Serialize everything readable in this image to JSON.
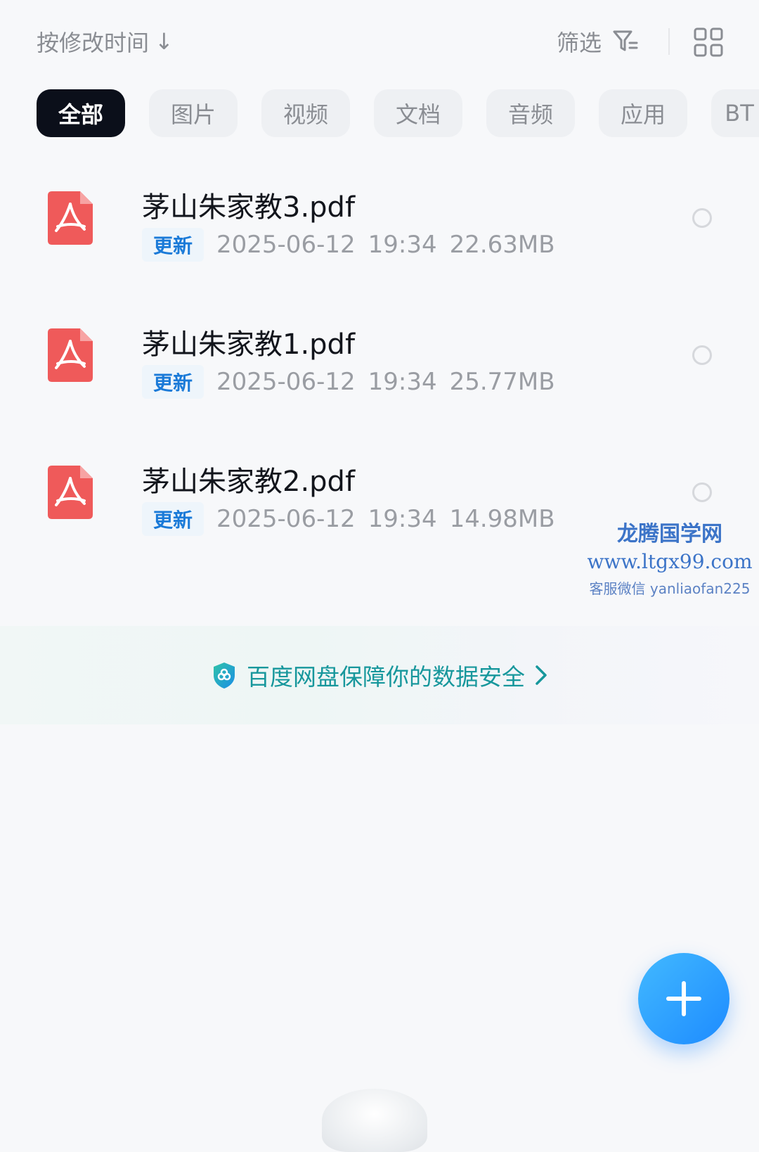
{
  "toolbar": {
    "sort_label": "按修改时间",
    "sort_arrow": "↓",
    "filter_label": "筛选"
  },
  "tabs": [
    {
      "label": "全部",
      "active": true
    },
    {
      "label": "图片",
      "active": false
    },
    {
      "label": "视频",
      "active": false
    },
    {
      "label": "文档",
      "active": false
    },
    {
      "label": "音频",
      "active": false
    },
    {
      "label": "应用",
      "active": false
    },
    {
      "label": "BT",
      "active": false
    }
  ],
  "files": [
    {
      "name": "茅山朱家教3.pdf",
      "badge": "更新",
      "date": "2025-06-12",
      "time": "19:34",
      "size": "22.63MB",
      "type_icon": "pdf-icon"
    },
    {
      "name": "茅山朱家教1.pdf",
      "badge": "更新",
      "date": "2025-06-12",
      "time": "19:34",
      "size": "25.77MB",
      "type_icon": "pdf-icon"
    },
    {
      "name": "茅山朱家教2.pdf",
      "badge": "更新",
      "date": "2025-06-12",
      "time": "19:34",
      "size": "14.98MB",
      "type_icon": "pdf-icon"
    }
  ],
  "watermark": {
    "title": "龙腾国学网",
    "url": "www.ltgx99.com",
    "contact": "客服微信 yanliaofan225"
  },
  "safety_banner": {
    "text": "百度网盘保障你的数据安全"
  },
  "colors": {
    "accent_blue": "#1d8bff",
    "pdf_red": "#ef5a5a",
    "active_tab": "#0b0f1a",
    "safety_teal": "#17979c"
  }
}
